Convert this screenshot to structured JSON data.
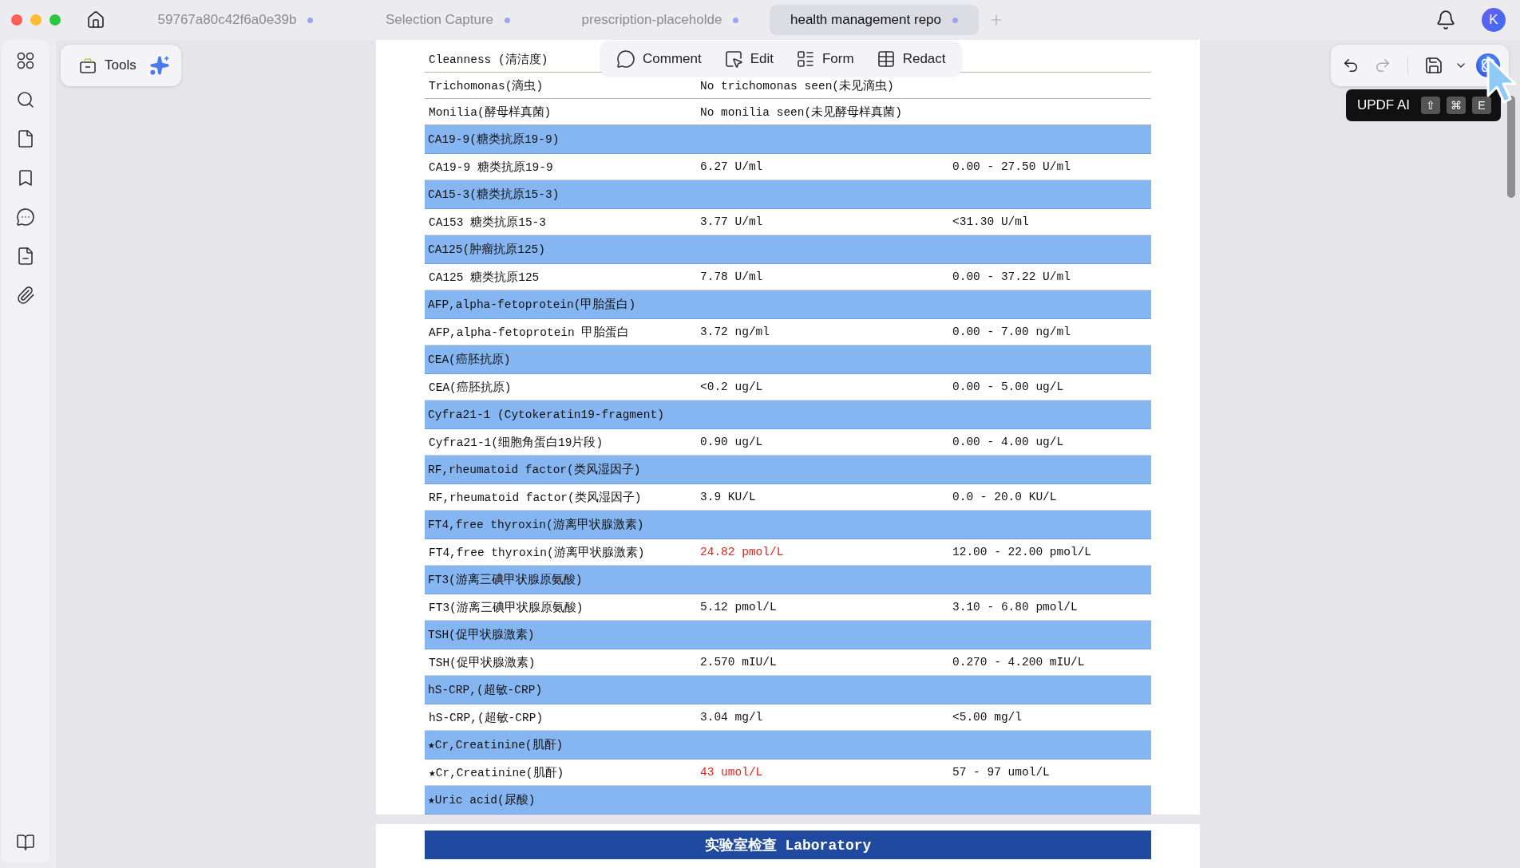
{
  "tabs": [
    {
      "label": "59767a80c42f6a0e39b",
      "selected": false
    },
    {
      "label": "Selection Capture",
      "selected": false
    },
    {
      "label": "prescription-placeholde",
      "selected": false
    },
    {
      "label": "health management repo",
      "selected": true
    }
  ],
  "avatar": "K",
  "tools_label": "Tools",
  "edit_toolbar": [
    {
      "kind": "comment",
      "label": "Comment"
    },
    {
      "kind": "edit",
      "label": "Edit"
    },
    {
      "kind": "form",
      "label": "Form"
    },
    {
      "kind": "redact",
      "label": "Redact"
    }
  ],
  "history": {
    "redo_disabled": true
  },
  "tooltip": {
    "label": "UPDF AI",
    "keys": [
      "⇧",
      "⌘",
      "E"
    ]
  },
  "rows": [
    {
      "kind": "plain",
      "name": "Cleanness (清洁度)"
    },
    {
      "kind": "plain",
      "name": "Trichomonas(滴虫)",
      "value": "No trichomonas seen(未见滴虫)"
    },
    {
      "kind": "plain",
      "name": "Monilia(酵母样真菌)",
      "value": "No monilia seen(未见酵母样真菌)"
    },
    {
      "kind": "section",
      "name": "CA19-9(糖类抗原19-9)"
    },
    {
      "kind": "result",
      "name": "CA19-9 糖类抗原19-9",
      "value": "6.27 U/ml",
      "range": "0.00 - 27.50 U/ml",
      "abnormal": false
    },
    {
      "kind": "section",
      "name": "CA15-3(糖类抗原15-3)"
    },
    {
      "kind": "result",
      "name": "CA153 糖类抗原15-3",
      "value": "3.77 U/ml",
      "range": "<31.30 U/ml",
      "abnormal": false
    },
    {
      "kind": "section",
      "name": "CA125(肿瘤抗原125)"
    },
    {
      "kind": "result",
      "name": "CA125 糖类抗原125",
      "value": "7.78 U/ml",
      "range": "0.00 - 37.22 U/ml",
      "abnormal": false
    },
    {
      "kind": "section",
      "name": "AFP,alpha-fetoprotein(甲胎蛋白)"
    },
    {
      "kind": "result",
      "name": "AFP,alpha-fetoprotein 甲胎蛋白",
      "value": "3.72 ng/ml",
      "range": "0.00 - 7.00 ng/ml",
      "abnormal": false
    },
    {
      "kind": "section",
      "name": "CEA(癌胚抗原)"
    },
    {
      "kind": "result",
      "name": "CEA(癌胚抗原)",
      "value": "<0.2 ug/L",
      "range": "0.00 - 5.00 ug/L",
      "abnormal": false
    },
    {
      "kind": "section",
      "name": "Cyfra21-1 (Cytokeratin19-fragment)"
    },
    {
      "kind": "result",
      "name": "Cyfra21-1(细胞角蛋白19片段)",
      "value": "0.90 ug/L",
      "range": "0.00 - 4.00 ug/L",
      "abnormal": false
    },
    {
      "kind": "section",
      "name": "RF,rheumatoid factor(类风湿因子)"
    },
    {
      "kind": "result",
      "name": "RF,rheumatoid factor(类风湿因子)",
      "value": "3.9 KU/L",
      "range": "0.0 - 20.0 KU/L",
      "abnormal": false
    },
    {
      "kind": "section",
      "name": "FT4,free thyroxin(游离甲状腺激素)"
    },
    {
      "kind": "result",
      "name": "FT4,free thyroxin(游离甲状腺激素)",
      "value": "24.82 pmol/L",
      "range": "12.00 - 22.00 pmol/L",
      "abnormal": true
    },
    {
      "kind": "section",
      "name": "FT3(游离三碘甲状腺原氨酸)"
    },
    {
      "kind": "result",
      "name": "FT3(游离三碘甲状腺原氨酸)",
      "value": "5.12 pmol/L",
      "range": "3.10 - 6.80 pmol/L",
      "abnormal": false
    },
    {
      "kind": "section",
      "name": "TSH(促甲状腺激素)"
    },
    {
      "kind": "result",
      "name": "TSH(促甲状腺激素)",
      "value": "2.570 mIU/L",
      "range": "0.270 - 4.200 mIU/L",
      "abnormal": false
    },
    {
      "kind": "section",
      "name": "hS-CRP,(超敏-CRP)"
    },
    {
      "kind": "result",
      "name": "hS-CRP,(超敏-CRP)",
      "value": "3.04 mg/l",
      "range": "<5.00 mg/l",
      "abnormal": false
    },
    {
      "kind": "section",
      "name": "★Cr,Creatinine(肌酐)"
    },
    {
      "kind": "result",
      "name": "★Cr,Creatinine(肌酐)",
      "value": "43 umol/L",
      "range": "57 - 97 umol/L",
      "abnormal": true
    },
    {
      "kind": "section",
      "name": "★Uric acid(尿酸)"
    }
  ],
  "next_page_heading": "实验室检查 Laboratory"
}
